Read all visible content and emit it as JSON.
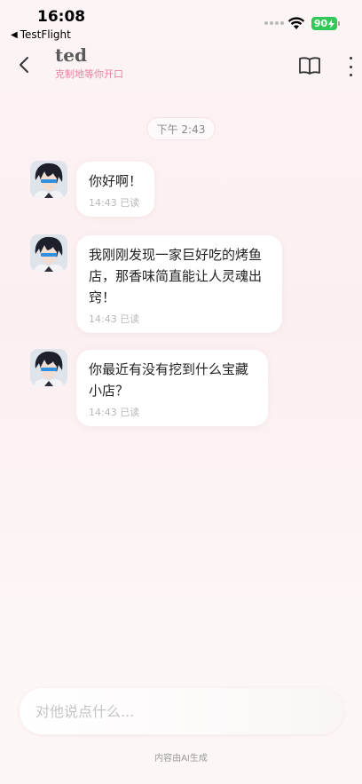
{
  "status_bar": {
    "time": "16:08",
    "back_app": "TestFlight",
    "back_glyph": "◀",
    "battery": "90"
  },
  "header": {
    "title": "ted",
    "subtitle": "克制地等你开口"
  },
  "chat": {
    "time_chip": "下午 2:43",
    "messages": [
      {
        "text": "你好啊！",
        "time": "14:43",
        "status": "已读"
      },
      {
        "text": "我刚刚发现一家巨好吃的烤鱼店，那香味简直能让人灵魂出窍！",
        "time": "14:43",
        "status": "已读"
      },
      {
        "text": "你最近有没有挖到什么宝藏小店？",
        "time": "14:43",
        "status": "已读"
      }
    ]
  },
  "input": {
    "placeholder": "对他说点什么...",
    "value": ""
  },
  "footer": {
    "disclaimer": "内容由AI生成"
  },
  "colors": {
    "accent": "#e9849f",
    "battery": "#34c759"
  }
}
